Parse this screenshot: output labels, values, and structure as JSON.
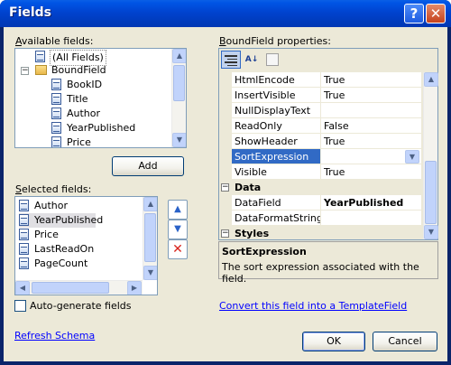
{
  "window": {
    "title": "Fields",
    "help_glyph": "?",
    "close_glyph": "✕"
  },
  "available": {
    "label": "Available fields:",
    "items": [
      "(All Fields)",
      "BoundField",
      "BookID",
      "Title",
      "Author",
      "YearPublished",
      "Price"
    ],
    "expander_glyph": "−"
  },
  "add_button": "Add",
  "selected": {
    "label": "Selected fields:",
    "items": [
      "Author",
      "YearPublished",
      "Price",
      "LastReadOn",
      "PageCount"
    ]
  },
  "move_buttons": {
    "up": "▲",
    "down": "▼",
    "delete": "✕"
  },
  "auto_generate": {
    "label": "Auto-generate fields",
    "checked": false
  },
  "refresh_schema": "Refresh Schema",
  "props": {
    "label": "BoundField properties:",
    "toolbar": {
      "categorized": "categorized-icon",
      "alpha_glyph": "A↓",
      "pages": "property-pages-icon"
    },
    "rows": [
      {
        "name": "HtmlEncode",
        "value": "True"
      },
      {
        "name": "InsertVisible",
        "value": "True"
      },
      {
        "name": "NullDisplayText",
        "value": ""
      },
      {
        "name": "ReadOnly",
        "value": "False"
      },
      {
        "name": "ShowHeader",
        "value": "True"
      },
      {
        "name": "SortExpression",
        "value": ""
      },
      {
        "name": "Visible",
        "value": "True"
      }
    ],
    "cat_data": "Data",
    "data_rows": [
      {
        "name": "DataField",
        "value": "YearPublished"
      },
      {
        "name": "DataFormatString",
        "value": ""
      }
    ],
    "cat_styles": "Styles",
    "desc_title": "SortExpression",
    "desc_text": "The sort expression associated with the field."
  },
  "convert_link": "Convert this field into a TemplateField",
  "ok_button": "OK",
  "cancel_button": "Cancel",
  "colors": {
    "selection": "#316ac5",
    "titlebar": "#0043cf",
    "dialog_bg": "#ece9d8",
    "link": "#0000ff"
  }
}
